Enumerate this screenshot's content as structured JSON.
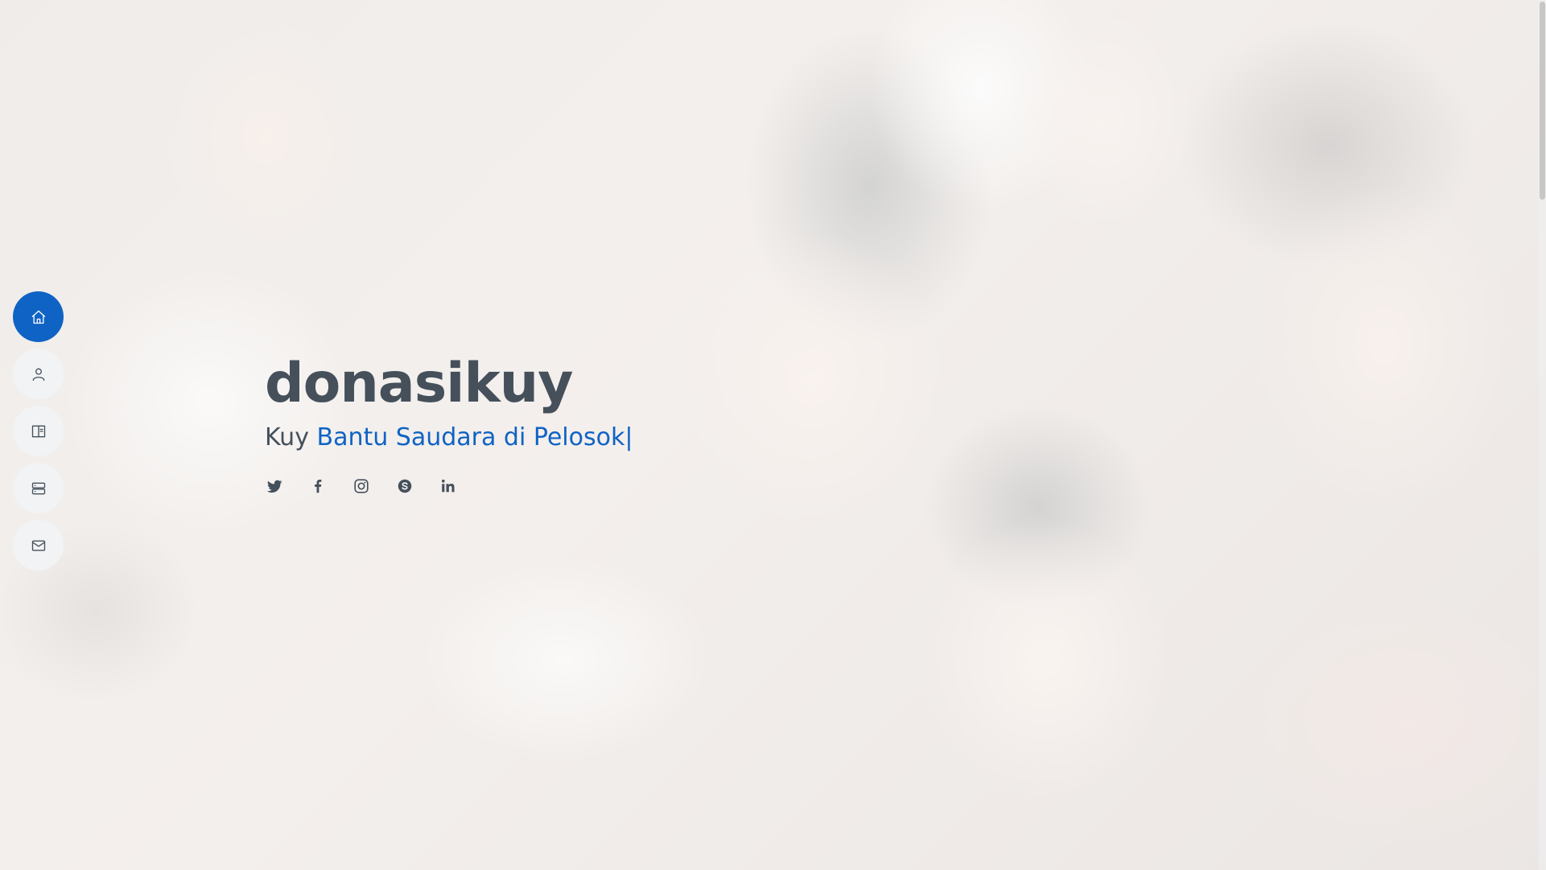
{
  "nav": {
    "items": [
      {
        "name": "home",
        "icon": "home-icon",
        "active": true
      },
      {
        "name": "about",
        "icon": "person-icon",
        "active": false
      },
      {
        "name": "resume",
        "icon": "book-icon",
        "active": false
      },
      {
        "name": "services",
        "icon": "server-icon",
        "active": false
      },
      {
        "name": "contact",
        "icon": "envelope-icon",
        "active": false
      }
    ]
  },
  "hero": {
    "title": "donasikuy",
    "subtitle_prefix": "Kuy",
    "typed_text": "Bantu Saudara di Pelosok",
    "caret": "|",
    "social": [
      "twitter-icon",
      "facebook-icon",
      "instagram-icon",
      "skype-icon",
      "linkedin-icon"
    ]
  },
  "colors": {
    "accent": "#0f63c4",
    "text": "#45505b",
    "nav_bg": "#f2f3f5"
  }
}
